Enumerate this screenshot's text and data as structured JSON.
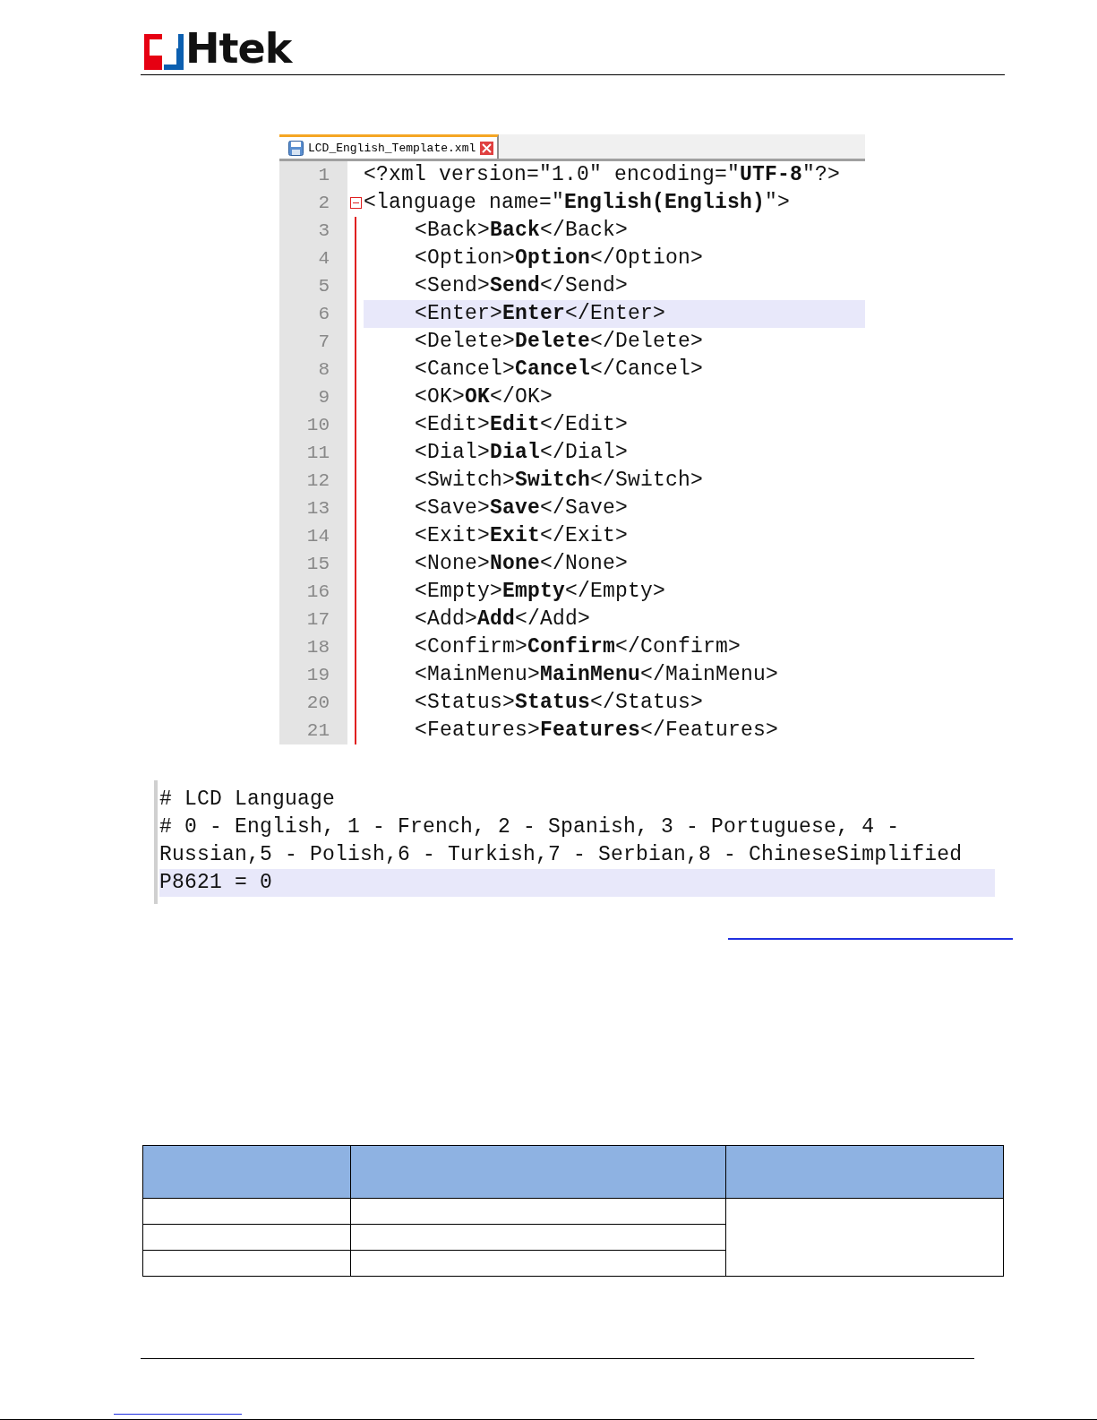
{
  "header": {
    "logo_text": "Htek"
  },
  "editor": {
    "tab": {
      "title": "LCD_English_Template.xml",
      "selected": true
    },
    "lines": [
      {
        "number": "1",
        "text": "<?xml version=\"1.0\" encoding=\"**UTF-8**\"?>",
        "selected": false
      },
      {
        "number": "2",
        "text": "<language name=\"**English(English)**\">",
        "selected": false,
        "expanded": true,
        "children": [
          {
            "number": "3",
            "text": "<Back>**Back**</Back>",
            "selected": false
          },
          {
            "number": "4",
            "text": "<Option>**Option**</Option>",
            "selected": false
          },
          {
            "number": "5",
            "text": "<Send>**Send**</Send>",
            "selected": false
          },
          {
            "number": "6",
            "text": "<Enter>**Enter**</Enter>",
            "selected": true
          },
          {
            "number": "7",
            "text": "<Delete>**Delete**</Delete>",
            "selected": false
          },
          {
            "number": "8",
            "text": "<Cancel>**Cancel**</Cancel>",
            "selected": false
          },
          {
            "number": "9",
            "text": "<OK>**OK**</OK>",
            "selected": false
          },
          {
            "number": "10",
            "text": "<Edit>**Edit**</Edit>",
            "selected": false
          },
          {
            "number": "11",
            "text": "<Dial>**Dial**</Dial>",
            "selected": false
          },
          {
            "number": "12",
            "text": "<Switch>**Switch**</Switch>",
            "selected": false
          },
          {
            "number": "13",
            "text": "<Save>**Save**</Save>",
            "selected": false
          },
          {
            "number": "14",
            "text": "<Exit>**Exit**</Exit>",
            "selected": false
          },
          {
            "number": "15",
            "text": "<None>**None**</None>",
            "selected": false
          },
          {
            "number": "16",
            "text": "<Empty>**Empty**</Empty>",
            "selected": false
          },
          {
            "number": "17",
            "text": "<Add>**Add**</Add>",
            "selected": false
          },
          {
            "number": "18",
            "text": "<Confirm>**Confirm**</Confirm>",
            "selected": false
          },
          {
            "number": "19",
            "text": "<MainMenu>**MainMenu**</MainMenu>",
            "selected": false
          },
          {
            "number": "20",
            "text": "<Status>**Status**</Status>",
            "selected": false
          },
          {
            "number": "21",
            "text": "<Features>**Features**</Features>",
            "selected": false
          }
        ]
      }
    ]
  },
  "config": {
    "lines": [
      {
        "text": "# LCD Language",
        "selected": false
      },
      {
        "text": "# 0 - English, 1 - French, 2 - Spanish, 3 - Portuguese, 4 -",
        "selected": false
      },
      {
        "text": "Russian,5 - Polish,6 - Turkish,7 - Serbian,8 - ChineseSimplified",
        "selected": false
      },
      {
        "text": "P8621 = 0",
        "selected": true
      }
    ]
  }
}
